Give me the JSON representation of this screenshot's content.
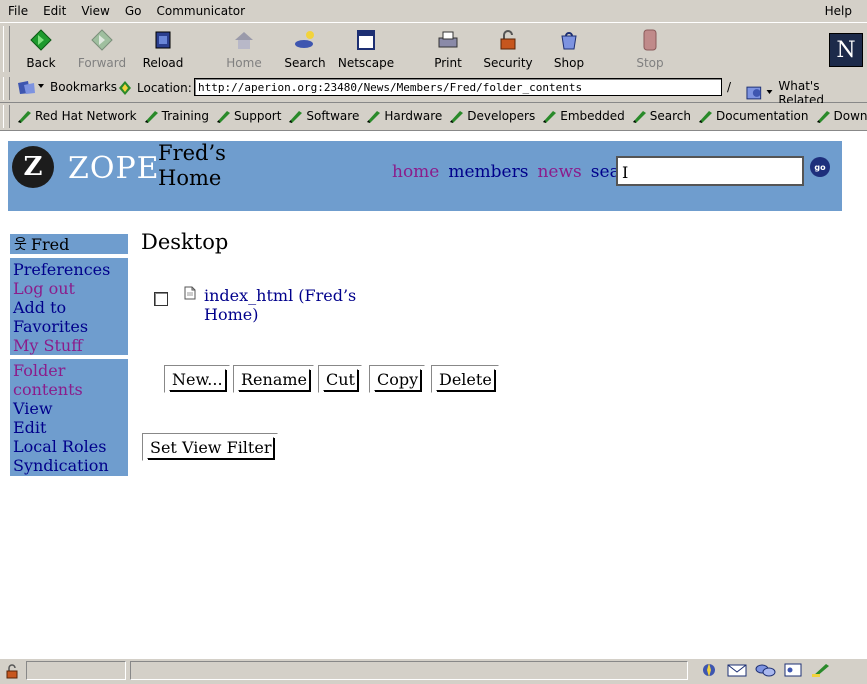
{
  "menu": {
    "items": [
      "File",
      "Edit",
      "View",
      "Go",
      "Communicator"
    ],
    "help": "Help"
  },
  "toolbar": {
    "buttons": [
      {
        "label": "Back",
        "icon": "back-arrow-icon",
        "enabled": true
      },
      {
        "label": "Forward",
        "icon": "forward-arrow-icon",
        "enabled": false
      },
      {
        "label": "Reload",
        "icon": "reload-icon",
        "enabled": true
      },
      {
        "label": "Home",
        "icon": "home-icon",
        "enabled": false
      },
      {
        "label": "Search",
        "icon": "search-icon",
        "enabled": true
      },
      {
        "label": "Netscape",
        "icon": "netscape-icon",
        "enabled": true
      },
      {
        "label": "Print",
        "icon": "print-icon",
        "enabled": true
      },
      {
        "label": "Security",
        "icon": "lock-icon",
        "enabled": true
      },
      {
        "label": "Shop",
        "icon": "shop-icon",
        "enabled": true
      },
      {
        "label": "Stop",
        "icon": "stop-icon",
        "enabled": false
      }
    ],
    "logo": "N"
  },
  "location": {
    "bookmarks_label": "Bookmarks",
    "location_label": "Location:",
    "url": "http://aperion.org:23480/News/Members/Fred/folder_contents",
    "related_label": "What's Related"
  },
  "personal_toolbar": {
    "links": [
      "Red Hat Network",
      "Training",
      "Support",
      "Software",
      "Hardware",
      "Developers",
      "Embedded",
      "Search",
      "Documentation",
      "Download"
    ]
  },
  "page": {
    "logo_text": "ZOPE",
    "title_line1": "Fred’s",
    "title_line2": "Home",
    "nav": {
      "home": "home",
      "members": "members",
      "news": "news",
      "search": "search"
    },
    "search_value": "",
    "go_label": "go",
    "user": "Fred",
    "member_links": [
      "Preferences",
      "Log out",
      "Add to Favorites",
      "My Stuff"
    ],
    "folder_links": [
      "Folder contents",
      "View",
      "Edit",
      "Local Roles",
      "Syndication"
    ],
    "heading": "Desktop",
    "items": [
      {
        "label": "index_html (Fred’s Home)"
      }
    ],
    "buttons": {
      "new": "New...",
      "rename": "Rename",
      "cut": "Cut",
      "copy": "Copy",
      "delete": "Delete"
    },
    "filter_button": "Set View Filter",
    "colors": {
      "banner": "#6f9dce",
      "link": "#00008b",
      "visited": "#8b1c8b"
    }
  }
}
